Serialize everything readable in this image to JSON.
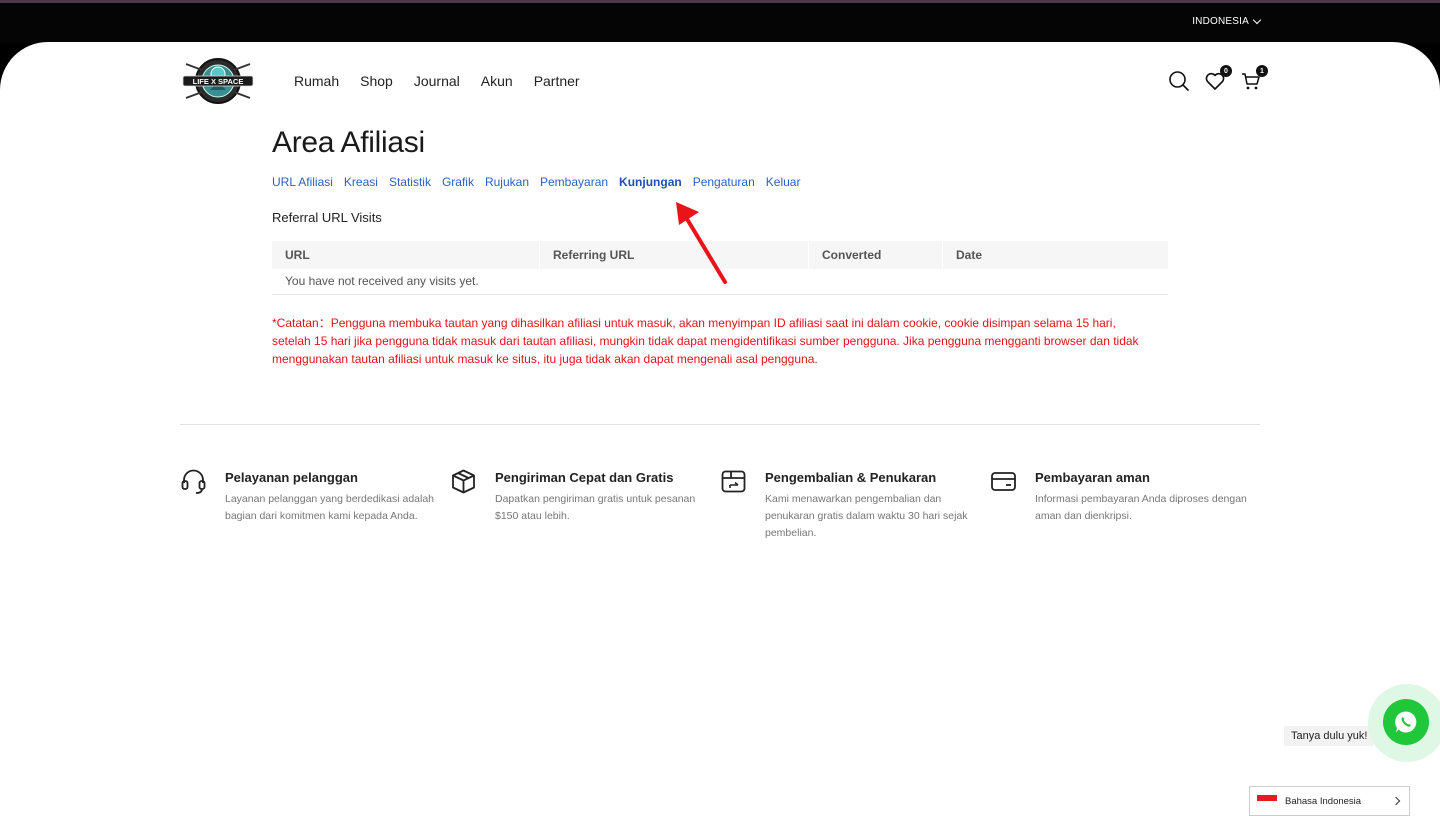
{
  "topbar": {
    "language": "INDONESIA"
  },
  "header": {
    "logo_text": "LIFE X SPACE",
    "nav": [
      "Rumah",
      "Shop",
      "Journal",
      "Akun",
      "Partner"
    ],
    "wishlist_count": "0",
    "cart_count": "1"
  },
  "main": {
    "title": "Area Afiliasi",
    "tabs": [
      {
        "label": "URL Afiliasi"
      },
      {
        "label": "Kreasi"
      },
      {
        "label": "Statistik"
      },
      {
        "label": "Grafik"
      },
      {
        "label": "Rujukan"
      },
      {
        "label": "Pembayaran"
      },
      {
        "label": "Kunjungan",
        "active": true
      },
      {
        "label": "Pengaturan"
      },
      {
        "label": "Keluar"
      }
    ],
    "section_title": "Referral URL Visits",
    "table": {
      "columns": [
        "URL",
        "Referring URL",
        "Converted",
        "Date"
      ],
      "empty_message": "You have not received any visits yet."
    },
    "note": "*Catatan：Pengguna membuka tautan yang dihasilkan afiliasi untuk masuk, akan menyimpan ID afiliasi saat ini dalam cookie, cookie disimpan selama 15 hari, setelah 15 hari jika pengguna tidak masuk dari tautan afiliasi, mungkin tidak dapat mengidentifikasi sumber pengguna. Jika pengguna mengganti browser dan tidak menggunakan tautan afiliasi untuk masuk ke situs, itu juga tidak akan dapat mengenali asal pengguna."
  },
  "features": [
    {
      "icon": "headset-icon",
      "title": "Pelayanan pelanggan",
      "text": "Layanan pelanggan yang berdedikasi adalah bagian dari komitmen kami kepada Anda."
    },
    {
      "icon": "box-icon",
      "title": "Pengiriman Cepat dan Gratis",
      "text": "Dapatkan pengiriman gratis untuk pesanan $150 atau lebih."
    },
    {
      "icon": "return-box-icon",
      "title": "Pengembalian & Penukaran",
      "text": "Kami menawarkan pengembalian dan penukaran gratis dalam waktu 30 hari sejak pembelian."
    },
    {
      "icon": "credit-card-icon",
      "title": "Pembayaran aman",
      "text": "Informasi pembayaran Anda diproses dengan aman dan dienkripsi."
    }
  ],
  "whatsapp": {
    "label": "Tanya dulu yuk!"
  },
  "language_switcher": {
    "label": "Bahasa Indonesia"
  },
  "colors": {
    "link": "#2a62c4",
    "note": "#e0141a",
    "whatsapp": "#20c73a",
    "annotation_arrow": "#e8141a"
  }
}
